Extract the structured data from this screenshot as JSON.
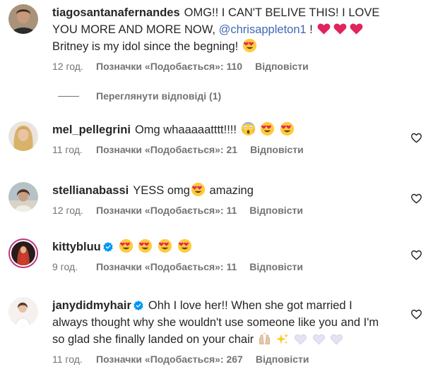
{
  "colors": {
    "text": "#262626",
    "secondary": "#737373",
    "mention": "#3f68b8",
    "verified": "#0095f6"
  },
  "comments": [
    {
      "username": "tiagosantanafernandes",
      "text_before": "OMG!! I CAN'T BELIVE THIS! I LOVE YOU MORE AND MORE NOW, ",
      "mention": "@chrisappleton1",
      "text_mid": " ! ",
      "text_after": " Britney is my idol since the begning! ",
      "time": "12 год.",
      "likes": "Позначки «Подобається»: 110",
      "reply": "Відповісти",
      "emoji": [
        "red-heart-icon",
        "red-heart-icon",
        "red-heart-icon",
        "heart-eyes-icon"
      ]
    },
    {
      "username": "mel_pellegrini",
      "text": "Omg whaaaaatttt!!!! ",
      "time": "11 год.",
      "likes": "Позначки «Подобається»: 21",
      "reply": "Відповісти",
      "emoji": [
        "screaming-face-icon",
        "heart-eyes-icon",
        "heart-eyes-icon"
      ]
    },
    {
      "username": "stellianabassi",
      "text_before": "YESS omg",
      "text_after": " amazing",
      "time": "12 год.",
      "likes": "Позначки «Подобається»: 11",
      "reply": "Відповісти",
      "emoji": [
        "heart-eyes-icon"
      ]
    },
    {
      "username": "kittybluu",
      "text": "",
      "time": "9 год.",
      "likes": "Позначки «Подобається»: 11",
      "reply": "Відповісти",
      "verified": true,
      "emoji": [
        "heart-eyes-icon",
        "heart-eyes-icon",
        "heart-eyes-icon",
        "heart-eyes-icon"
      ]
    },
    {
      "username": "janydidmyhair",
      "text": "Ohh I love her!! When she got married I always thought why she wouldn't use someone like you and I'm so glad she finally landed on your chair ",
      "time": "11 год.",
      "likes": "Позначки «Подобається»: 267",
      "reply": "Відповісти",
      "verified": true,
      "emoji": [
        "raised-hands-icon",
        "sparkles-icon",
        "white-heart-icon",
        "white-heart-icon",
        "white-heart-icon"
      ]
    }
  ],
  "view_replies": "Переглянути відповіді (1)"
}
